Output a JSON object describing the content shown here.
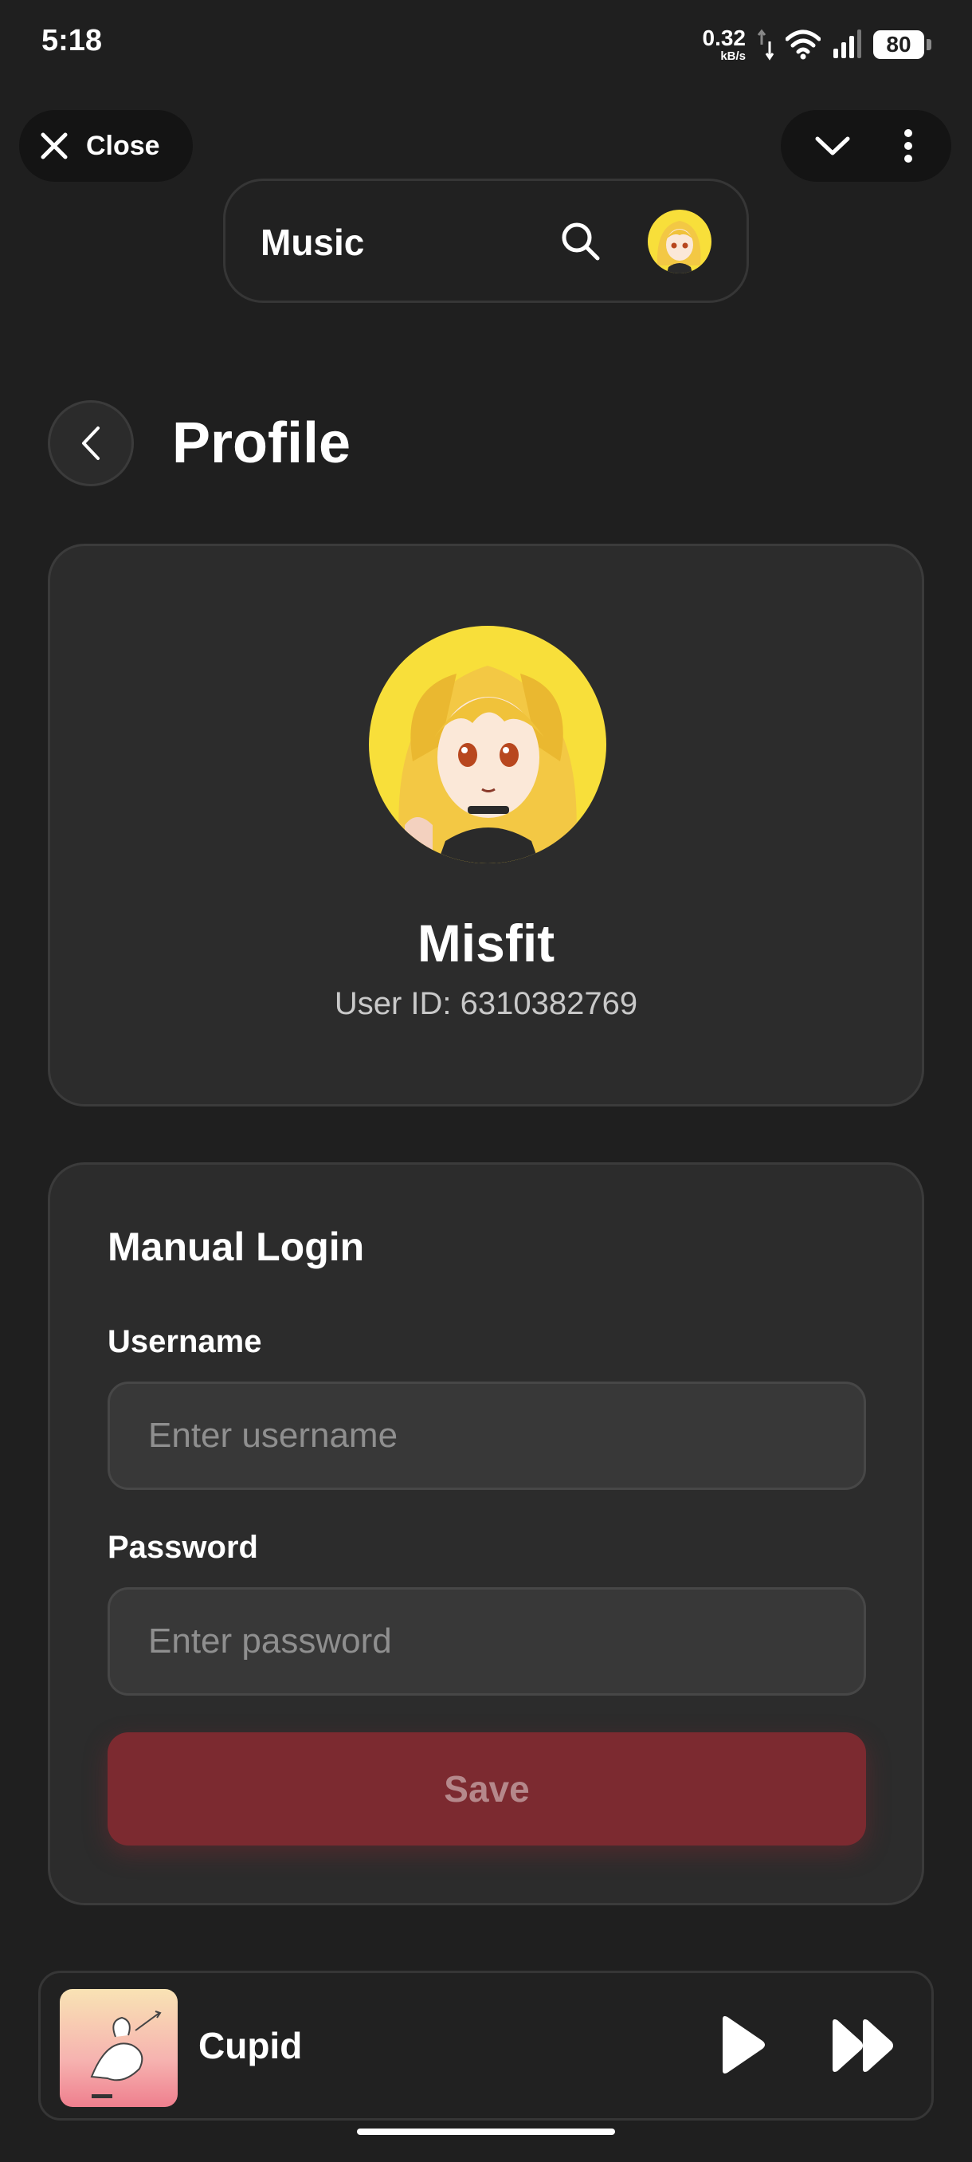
{
  "status_bar": {
    "time": "5:18",
    "net_speed_value": "0.32",
    "net_speed_unit": "kB/s",
    "battery": "80"
  },
  "top_bar": {
    "close_label": "Close"
  },
  "app_header": {
    "title": "Music"
  },
  "profile": {
    "page_title": "Profile",
    "name": "Misfit",
    "user_id": "User ID: 6310382769"
  },
  "manual_login": {
    "title": "Manual Login",
    "username_label": "Username",
    "username_placeholder": "Enter username",
    "username_value": "",
    "password_label": "Password",
    "password_placeholder": "Enter password",
    "password_value": "",
    "save_label": "Save"
  },
  "mini_player": {
    "track_title": "Cupid"
  },
  "colors": {
    "background": "#1f1f1f",
    "card": "#2c2c2c",
    "save_button": "#7c2a30",
    "avatar_yellow": "#f8df3a"
  },
  "icons": [
    "close-icon",
    "chevron-down-icon",
    "more-vert-icon",
    "search-icon",
    "back-icon",
    "play-icon",
    "skip-next-icon",
    "wifi-icon",
    "signal-icon",
    "battery-icon"
  ]
}
